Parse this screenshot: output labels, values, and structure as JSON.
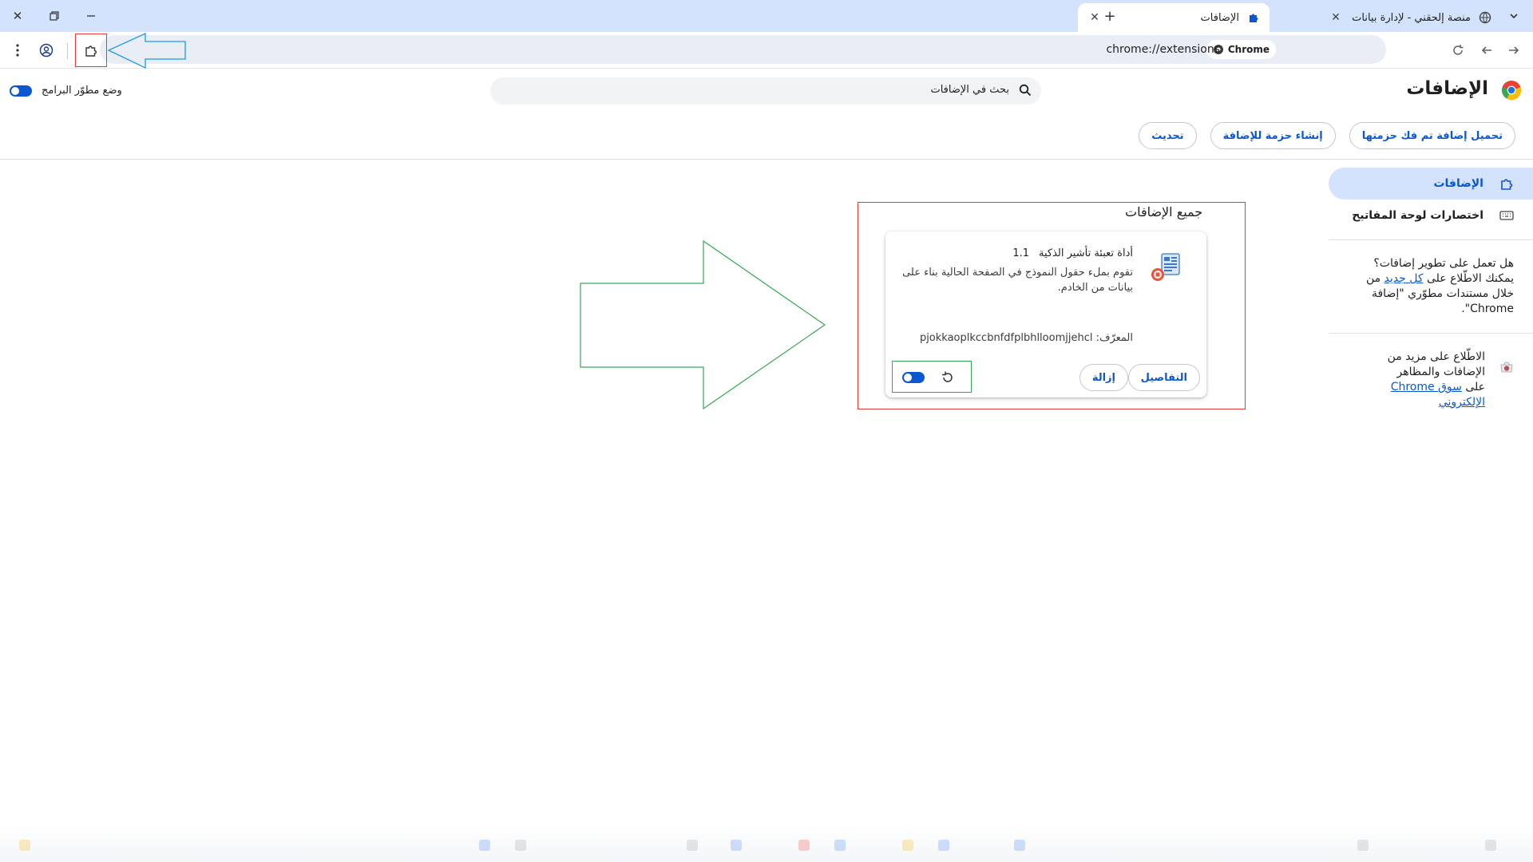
{
  "browser": {
    "tabs": [
      {
        "title": "الإضافات",
        "active": true
      },
      {
        "title": "منصة إلحقني - لإدارة بيانات المنـ",
        "active": false
      }
    ],
    "url": "chrome://extensions",
    "chip_label": "Chrome"
  },
  "page": {
    "title": "الإضافات",
    "search_placeholder": "بحث في الإضافات",
    "dev_mode_label": "وضع مطوّر البرامج",
    "dev_mode_on": true,
    "actions": [
      "تحميل إضافة تم فك حزمتها",
      "إنشاء حزمة للإضافة",
      "تحديث"
    ]
  },
  "sidebar": {
    "items": [
      {
        "label": "الإضافات",
        "icon": "puzzle-icon",
        "active": true
      },
      {
        "label": "اختصارات لوحة المفاتيح",
        "icon": "keyboard-icon",
        "active": false
      }
    ],
    "dev_note_prefix": "هل تعمل على تطوير إضافات؟ يمكنك الاطّلاع على ",
    "dev_note_link": "كل جديد",
    "dev_note_suffix": " من خلال مستندات مطوّري \"إضافة Chrome\".",
    "cws_text": "الاطّلاع على مزيد من الإضافات والمظاهر على ",
    "cws_link": "سوق Chrome الإلكتروني"
  },
  "extensions": {
    "section_title": "جميع الإضافات",
    "items": [
      {
        "name": "أداة تعبئة تأشير الذكية",
        "version": "1.1",
        "description": "تقوم بملء حقول النموذج في الصفحة الحالية بناء على بيانات من الخادم.",
        "id_label": "المعرّف: pjokkaoplkccbnfdfplbhlloomjjehcl",
        "details_label": "التفاصيل",
        "remove_label": "إزالة",
        "enabled": true
      }
    ]
  },
  "colors": {
    "accent": "#0b57d0",
    "annotation_red": "#e53935",
    "annotation_green": "#34a853",
    "annotation_blue": "#1a9be6"
  }
}
